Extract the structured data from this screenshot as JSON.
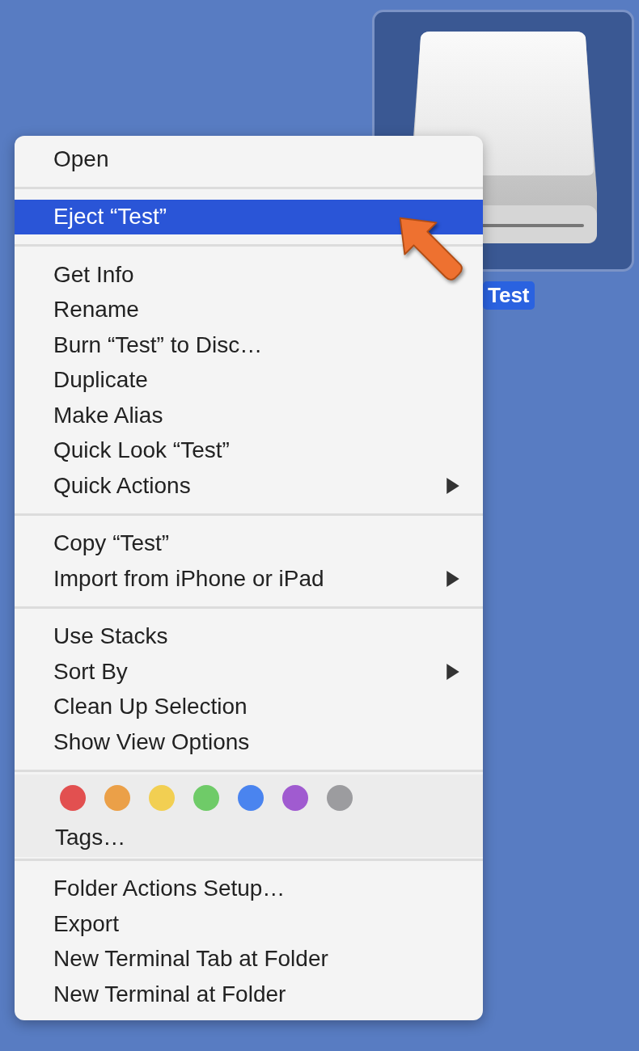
{
  "desktop_icon": {
    "label": "Test",
    "selected": true
  },
  "context_menu": {
    "sections": [
      {
        "kind": "items",
        "items": [
          {
            "label": "Open",
            "selected": false,
            "submenu": false
          }
        ]
      },
      {
        "kind": "items",
        "items": [
          {
            "label": "Eject “Test”",
            "selected": true,
            "submenu": false
          }
        ]
      },
      {
        "kind": "items",
        "items": [
          {
            "label": "Get Info",
            "selected": false,
            "submenu": false
          },
          {
            "label": "Rename",
            "selected": false,
            "submenu": false
          },
          {
            "label": "Burn “Test” to Disc…",
            "selected": false,
            "submenu": false
          },
          {
            "label": "Duplicate",
            "selected": false,
            "submenu": false
          },
          {
            "label": "Make Alias",
            "selected": false,
            "submenu": false
          },
          {
            "label": "Quick Look “Test”",
            "selected": false,
            "submenu": false
          },
          {
            "label": "Quick Actions",
            "selected": false,
            "submenu": true
          }
        ]
      },
      {
        "kind": "items",
        "items": [
          {
            "label": "Copy “Test”",
            "selected": false,
            "submenu": false
          },
          {
            "label": "Import from iPhone or iPad",
            "selected": false,
            "submenu": true
          }
        ]
      },
      {
        "kind": "items",
        "items": [
          {
            "label": "Use Stacks",
            "selected": false,
            "submenu": false
          },
          {
            "label": "Sort By",
            "selected": false,
            "submenu": true
          },
          {
            "label": "Clean Up Selection",
            "selected": false,
            "submenu": false
          },
          {
            "label": "Show View Options",
            "selected": false,
            "submenu": false
          }
        ]
      },
      {
        "kind": "tags",
        "label": "Tags…",
        "tags": [
          {
            "color": "#e25050"
          },
          {
            "color": "#eba048"
          },
          {
            "color": "#f2cf52"
          },
          {
            "color": "#6fcb68"
          },
          {
            "color": "#4a84ef"
          },
          {
            "color": "#a05bd0"
          },
          {
            "color": "#9c9c9f"
          }
        ]
      },
      {
        "kind": "items",
        "items": [
          {
            "label": "Folder Actions Setup…",
            "selected": false,
            "submenu": false
          },
          {
            "label": "Export",
            "selected": false,
            "submenu": false
          },
          {
            "label": "New Terminal Tab at Folder",
            "selected": false,
            "submenu": false
          },
          {
            "label": "New Terminal at Folder",
            "selected": false,
            "submenu": false
          }
        ]
      }
    ]
  }
}
